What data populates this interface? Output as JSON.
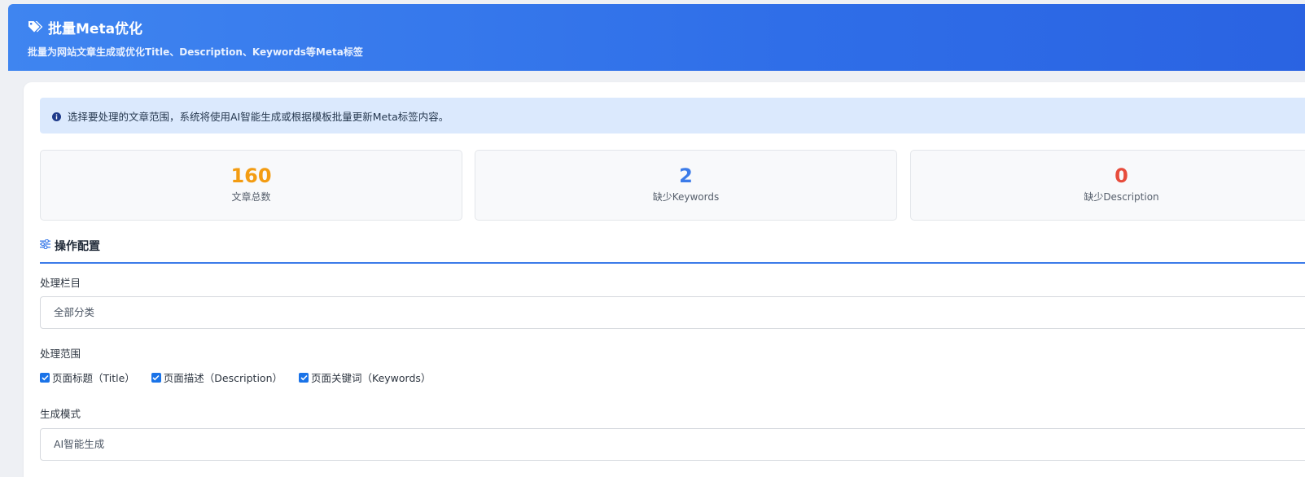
{
  "header": {
    "title": "批量Meta优化",
    "subtitle": "批量为网站文章生成或优化Title、Description、Keywords等Meta标签",
    "icon": "tags-icon"
  },
  "info": {
    "text": "选择要处理的文章范围，系统将使用AI智能生成或根据模板批量更新Meta标签内容。",
    "icon": "info-circle-icon"
  },
  "stats": [
    {
      "value": "160",
      "label": "文章总数",
      "color": "#f39c12"
    },
    {
      "value": "2",
      "label": "缺少Keywords",
      "color": "#3b7be9"
    },
    {
      "value": "0",
      "label": "缺少Description",
      "color": "#e74c3c"
    }
  ],
  "config": {
    "title": "操作配置",
    "icon": "sliders-icon",
    "category_label": "处理栏目",
    "category_value": "全部分类",
    "scope_label": "处理范围",
    "scope_options": [
      {
        "label": "页面标题（Title）",
        "checked": true
      },
      {
        "label": "页面描述（Description）",
        "checked": true
      },
      {
        "label": "页面关键词（Keywords）",
        "checked": true
      }
    ],
    "mode_label": "生成模式",
    "mode_value": "AI智能生成"
  },
  "colors": {
    "accent": "#3b7be9",
    "header_start": "#3f85f0",
    "header_end": "#2a63e2",
    "info_bg": "#dbe9fd"
  }
}
